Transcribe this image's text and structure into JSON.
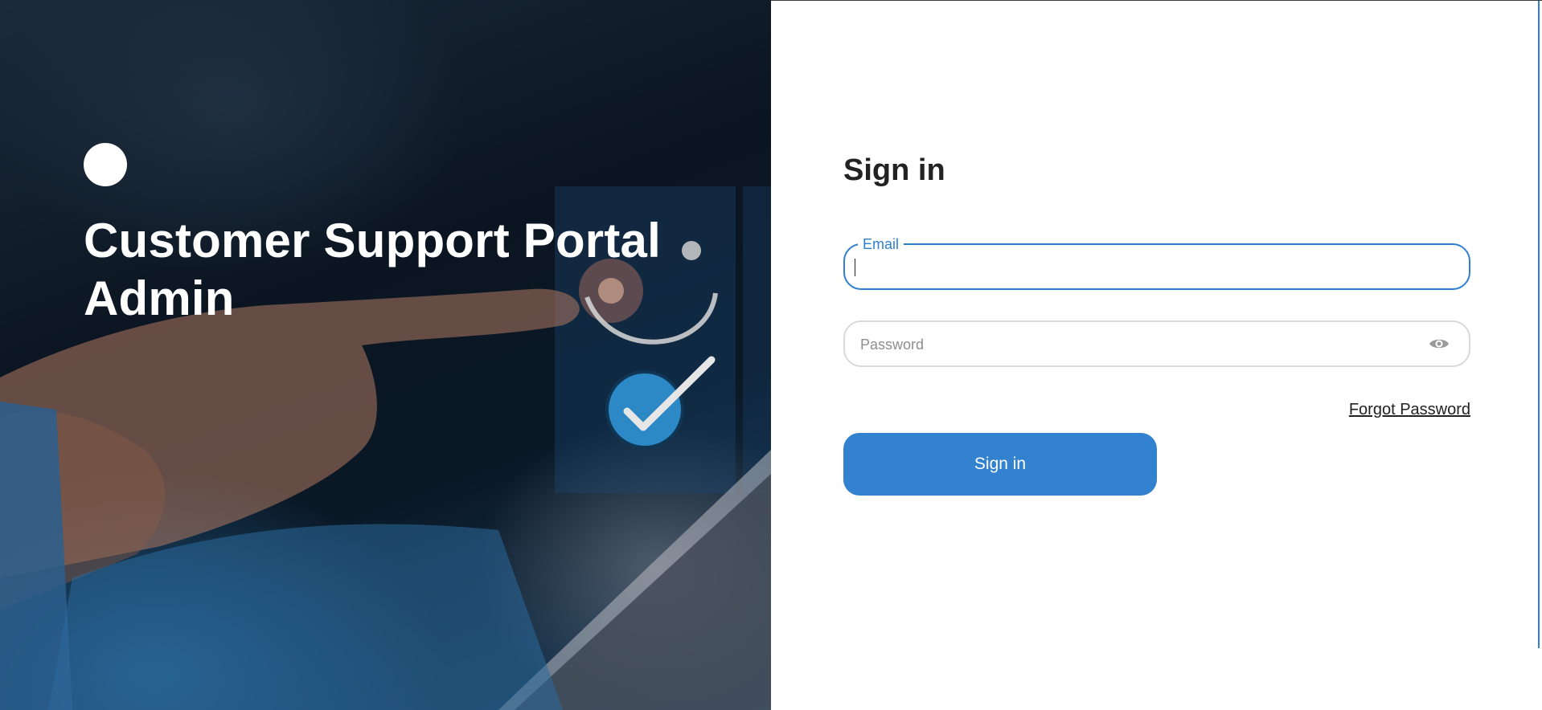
{
  "hero": {
    "title_line1": "Customer Support Portal",
    "title_line2": "Admin",
    "logo_color": "#ffffff"
  },
  "form": {
    "title": "Sign in",
    "email": {
      "label": "Email",
      "value": ""
    },
    "password": {
      "placeholder": "Password",
      "value": "",
      "toggle_icon": "eye-icon"
    },
    "forgot_link": "Forgot Password",
    "submit_label": "Sign in"
  },
  "colors": {
    "accent": "#3282cf",
    "field_border": "#d9d9d9",
    "text": "#222222",
    "hero_dark": "#0b1521"
  }
}
